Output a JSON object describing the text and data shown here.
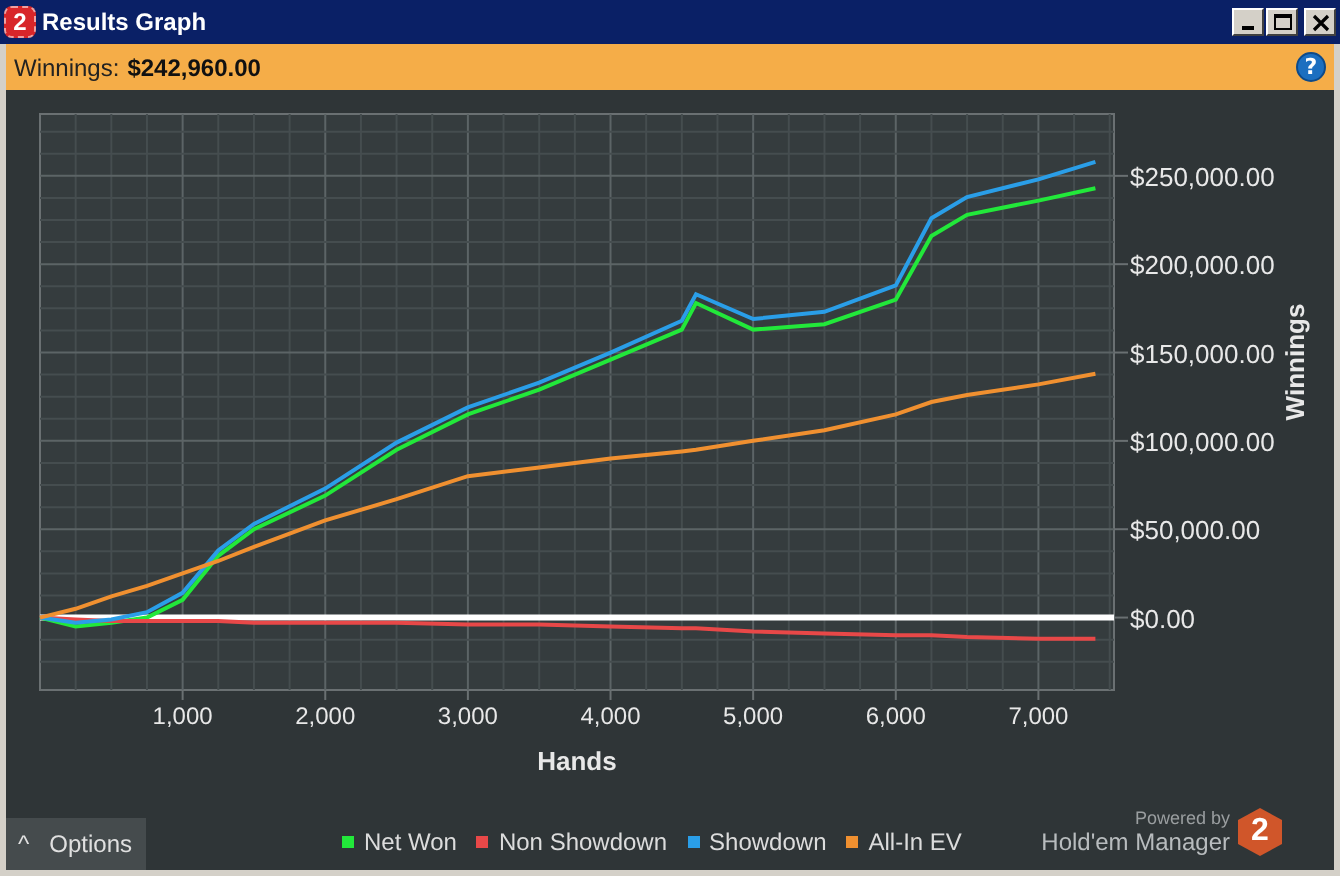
{
  "window": {
    "title": "Results Graph",
    "icon_label": "2"
  },
  "summary": {
    "label": "Winnings:",
    "value": "$242,960.00",
    "help_label": "?"
  },
  "chart_data": {
    "type": "line",
    "xlabel": "Hands",
    "ylabel": "Winnings",
    "x": [
      0,
      250,
      500,
      750,
      1000,
      1250,
      1500,
      2000,
      2500,
      3000,
      3500,
      4000,
      4500,
      4600,
      5000,
      5500,
      6000,
      6250,
      6500,
      7000,
      7400
    ],
    "series": [
      {
        "name": "Net Won",
        "color": "#22e83a",
        "values": [
          0,
          -5000,
          -3000,
          0,
          10000,
          35000,
          50000,
          69000,
          95000,
          115000,
          129000,
          146000,
          163000,
          178000,
          163000,
          166000,
          180000,
          216000,
          228000,
          236000,
          243000
        ]
      },
      {
        "name": "Non Showdown",
        "color": "#e84848",
        "values": [
          0,
          -1000,
          -2000,
          -2000,
          -2000,
          -2000,
          -3000,
          -3000,
          -3000,
          -4000,
          -4000,
          -5000,
          -6000,
          -6000,
          -8000,
          -9000,
          -10000,
          -10000,
          -11000,
          -12000,
          -12000
        ]
      },
      {
        "name": "Showdown",
        "color": "#2a9ee8",
        "values": [
          0,
          -3000,
          -1000,
          3000,
          14000,
          38000,
          53000,
          73000,
          99000,
          119000,
          133000,
          150000,
          168000,
          183000,
          169000,
          173000,
          188000,
          226000,
          238000,
          248000,
          258000
        ]
      },
      {
        "name": "All-In EV",
        "color": "#f09030",
        "values": [
          0,
          5000,
          12000,
          18000,
          25000,
          32000,
          40000,
          55000,
          67000,
          80000,
          85000,
          90000,
          94000,
          95000,
          100000,
          106000,
          115000,
          122000,
          126000,
          132000,
          138000
        ]
      }
    ],
    "xlim": [
      0,
      7530
    ],
    "grid": true,
    "ylim": [
      -41000,
      285000
    ],
    "xticks": [
      {
        "value": 1000,
        "label": "1,000"
      },
      {
        "value": 2000,
        "label": "2,000"
      },
      {
        "value": 3000,
        "label": "3,000"
      },
      {
        "value": 4000,
        "label": "4,000"
      },
      {
        "value": 5000,
        "label": "5,000"
      },
      {
        "value": 6000,
        "label": "6,000"
      },
      {
        "value": 7000,
        "label": "7,000"
      }
    ],
    "yticks": [
      {
        "value": 0,
        "label": "$0.00"
      },
      {
        "value": 50000,
        "label": "$50,000.00"
      },
      {
        "value": 100000,
        "label": "$100,000.00"
      },
      {
        "value": 150000,
        "label": "$150,000.00"
      },
      {
        "value": 200000,
        "label": "$200,000.00"
      },
      {
        "value": 250000,
        "label": "$250,000.00"
      }
    ]
  },
  "options_button": {
    "label": "Options",
    "caret": "^"
  },
  "branding": {
    "powered_by": "Powered by",
    "product": "Hold'em Manager",
    "logo_label": "2"
  }
}
